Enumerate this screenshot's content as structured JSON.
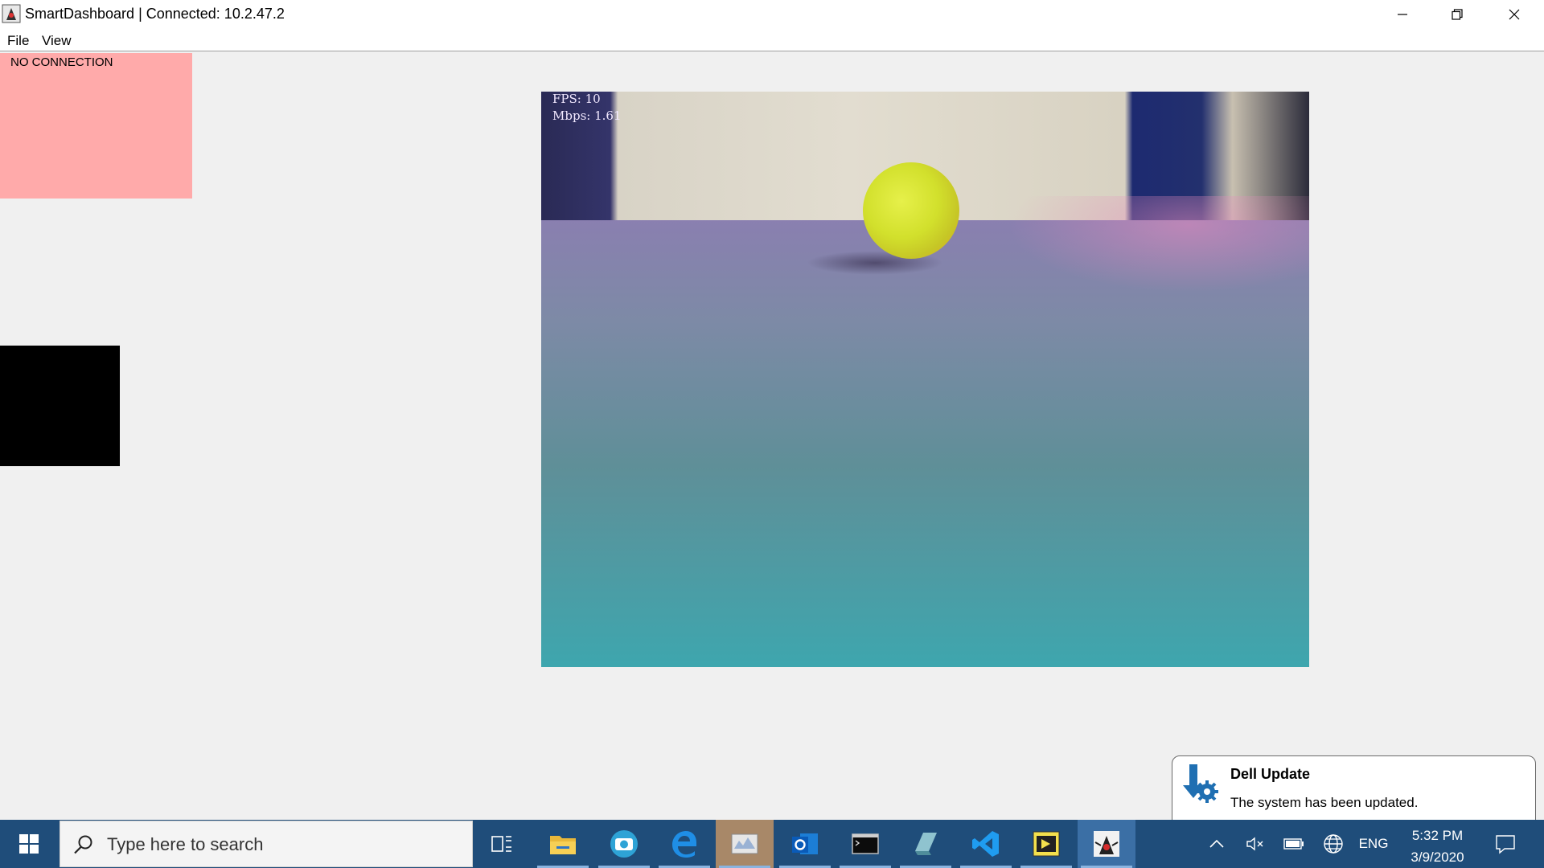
{
  "window": {
    "title": "SmartDashboard | Connected: 10.2.47.2",
    "app_icon": "java-duke-icon"
  },
  "menu": {
    "items": [
      {
        "label": "File"
      },
      {
        "label": "View"
      }
    ]
  },
  "widgets": {
    "connection_status": "NO CONNECTION",
    "connection_color": "#ffaaaa"
  },
  "camera": {
    "fps_label": "FPS: 10",
    "mbps_label": "Mbps: 1.61"
  },
  "notification": {
    "title": "Dell Update",
    "body": "The system has been updated.",
    "icon": "dell-update-gear-icon"
  },
  "taskbar": {
    "search_placeholder": "Type here to search",
    "apps": [
      {
        "name": "task-view-icon"
      },
      {
        "name": "file-explorer-icon"
      },
      {
        "name": "camera-app-icon"
      },
      {
        "name": "edge-icon"
      },
      {
        "name": "driver-station-icon"
      },
      {
        "name": "outlook-icon"
      },
      {
        "name": "terminal-icon"
      },
      {
        "name": "gradle-icon"
      },
      {
        "name": "vscode-icon"
      },
      {
        "name": "labview-icon"
      },
      {
        "name": "smartdashboard-java-icon"
      }
    ],
    "tray": {
      "language": "ENG",
      "time": "5:32 PM",
      "date": "3/9/2020"
    }
  }
}
